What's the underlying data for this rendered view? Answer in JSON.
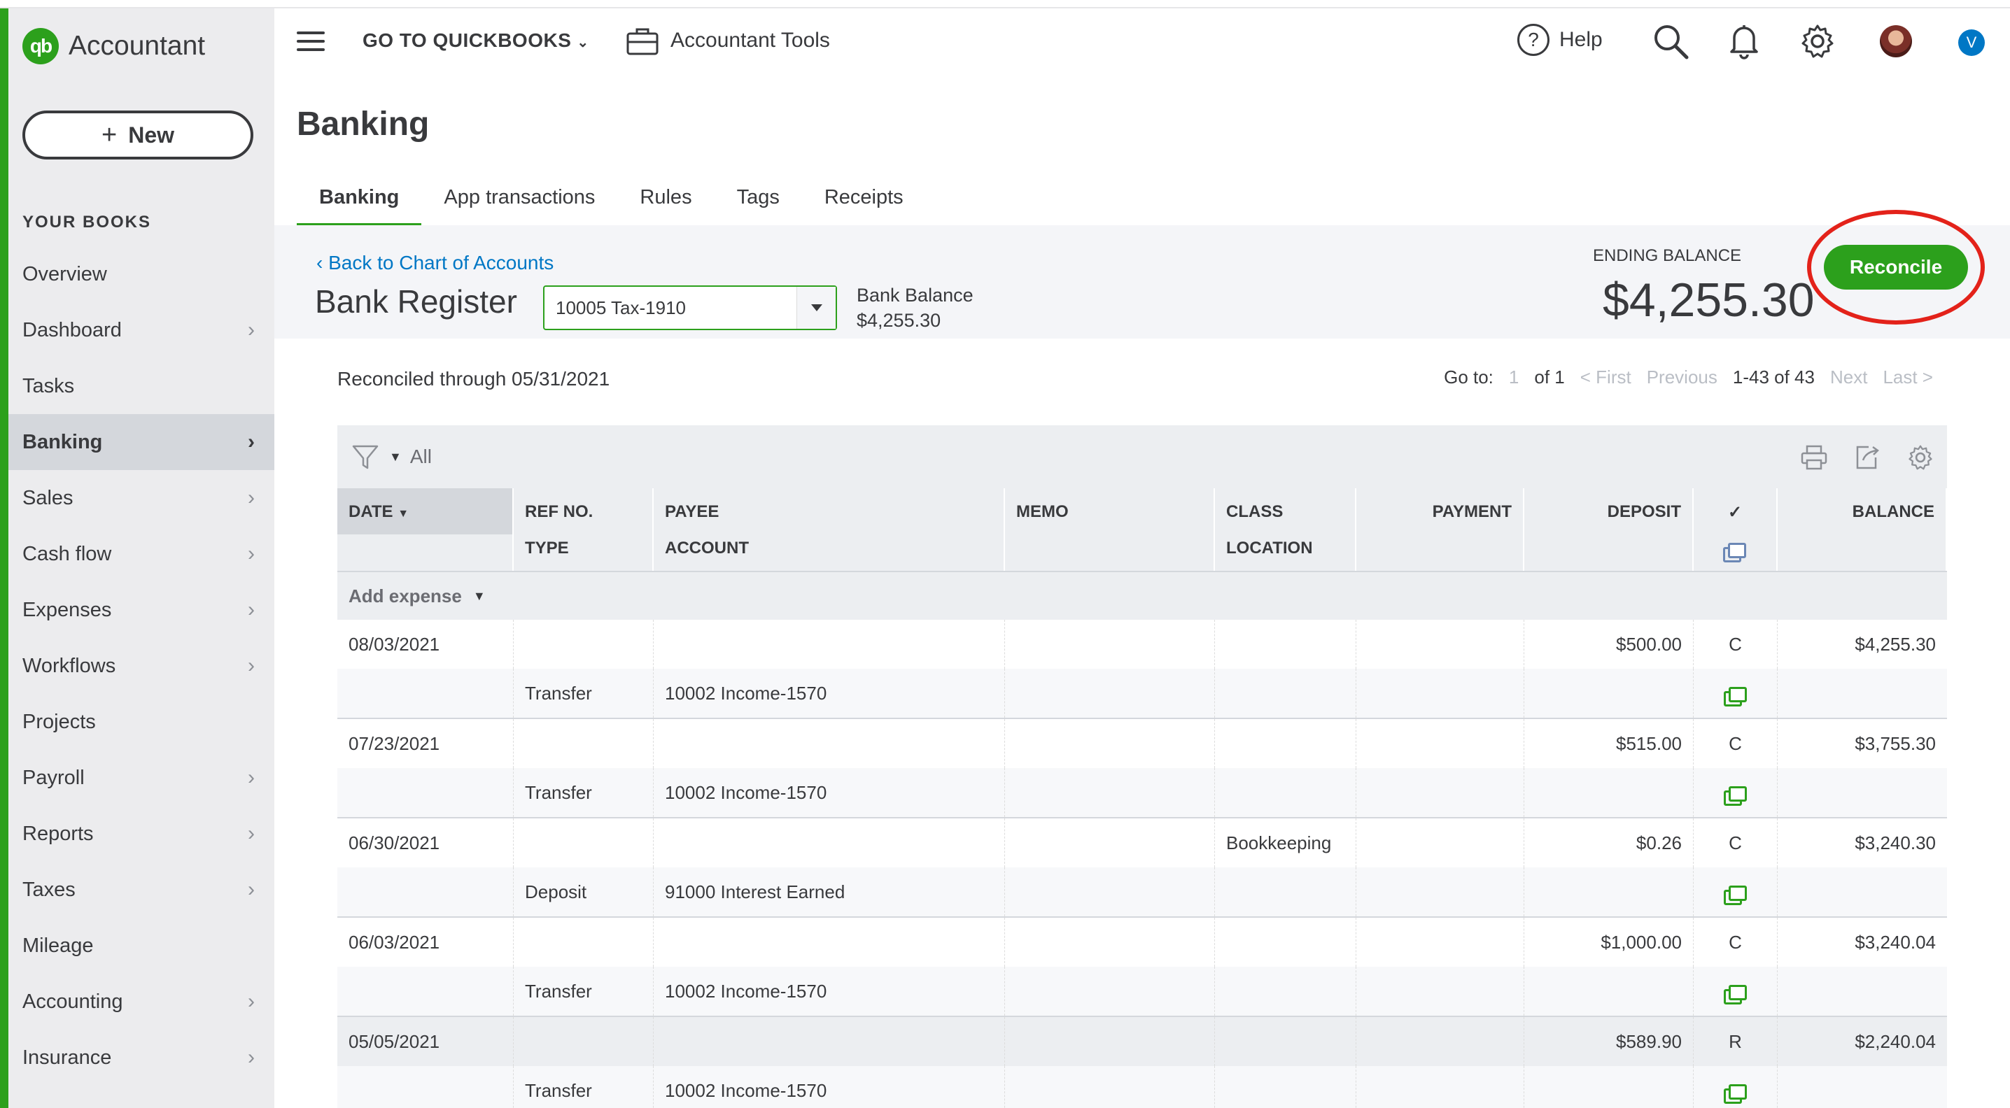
{
  "app": {
    "brand": "Accountant",
    "logo_text": "qb"
  },
  "sidebar": {
    "new_label": "New",
    "section_label": "YOUR BOOKS",
    "items": [
      {
        "label": "Overview",
        "chevron": false
      },
      {
        "label": "Dashboard",
        "chevron": true
      },
      {
        "label": "Tasks",
        "chevron": false
      },
      {
        "label": "Banking",
        "chevron": true,
        "active": true
      },
      {
        "label": "Sales",
        "chevron": true
      },
      {
        "label": "Cash flow",
        "chevron": true
      },
      {
        "label": "Expenses",
        "chevron": true
      },
      {
        "label": "Workflows",
        "chevron": true
      },
      {
        "label": "Projects",
        "chevron": false
      },
      {
        "label": "Payroll",
        "chevron": true
      },
      {
        "label": "Reports",
        "chevron": true
      },
      {
        "label": "Taxes",
        "chevron": true
      },
      {
        "label": "Mileage",
        "chevron": false
      },
      {
        "label": "Accounting",
        "chevron": true
      },
      {
        "label": "Insurance",
        "chevron": true
      }
    ]
  },
  "topbar": {
    "goto_label": "GO TO QUICKBOOKS",
    "tools_label": "Accountant Tools",
    "help_label": "Help",
    "user_initial": "V"
  },
  "page": {
    "title": "Banking",
    "tabs": [
      "Banking",
      "App transactions",
      "Rules",
      "Tags",
      "Receipts"
    ],
    "active_tab": "Banking"
  },
  "register": {
    "back_link": "Back to Chart of Accounts",
    "title": "Bank Register",
    "account_value": "10005 Tax-1910",
    "bank_balance_label": "Bank Balance",
    "bank_balance_value": "$4,255.30",
    "ending_balance_label": "ENDING BALANCE",
    "ending_balance_value": "$4,255.30",
    "reconcile_label": "Reconcile",
    "reconciled_through": "Reconciled through 05/31/2021"
  },
  "pager": {
    "goto_label": "Go to:",
    "page_value": "1",
    "of_label": "of 1",
    "first": "< First",
    "previous": "Previous",
    "range": "1-43 of 43",
    "next": "Next",
    "last": "Last >"
  },
  "table": {
    "filter_value": "All",
    "headers": {
      "date": "DATE",
      "ref": "REF NO.",
      "type": "TYPE",
      "payee": "PAYEE",
      "account": "ACCOUNT",
      "memo": "MEMO",
      "class": "CLASS",
      "location": "LOCATION",
      "payment": "PAYMENT",
      "deposit": "DEPOSIT",
      "check": "✓",
      "balance": "BALANCE"
    },
    "add_label": "Add expense",
    "rows": [
      {
        "date": "08/03/2021",
        "ref": "",
        "payee": "",
        "memo": "",
        "class": "",
        "payment": "",
        "deposit": "$500.00",
        "status": "C",
        "balance": "$4,255.30",
        "type": "Transfer",
        "account": "10002 Income-1570",
        "location": ""
      },
      {
        "date": "07/23/2021",
        "ref": "",
        "payee": "",
        "memo": "",
        "class": "",
        "payment": "",
        "deposit": "$515.00",
        "status": "C",
        "balance": "$3,755.30",
        "type": "Transfer",
        "account": "10002 Income-1570",
        "location": ""
      },
      {
        "date": "06/30/2021",
        "ref": "",
        "payee": "",
        "memo": "",
        "class": "Bookkeeping",
        "payment": "",
        "deposit": "$0.26",
        "status": "C",
        "balance": "$3,240.30",
        "type": "Deposit",
        "account": "91000 Interest Earned",
        "location": ""
      },
      {
        "date": "06/03/2021",
        "ref": "",
        "payee": "",
        "memo": "",
        "class": "",
        "payment": "",
        "deposit": "$1,000.00",
        "status": "C",
        "balance": "$3,240.04",
        "type": "Transfer",
        "account": "10002 Income-1570",
        "location": ""
      },
      {
        "date": "05/05/2021",
        "ref": "",
        "payee": "",
        "memo": "",
        "class": "",
        "payment": "",
        "deposit": "$589.90",
        "status": "R",
        "balance": "$2,240.04",
        "type": "Transfer",
        "account": "10002 Income-1570",
        "location": ""
      }
    ]
  },
  "colors": {
    "brand_green": "#2ca01c",
    "link_blue": "#0077c5",
    "highlight_red": "#e3221a"
  },
  "icons": [
    "hamburger-icon",
    "briefcase-icon",
    "help-icon",
    "search-icon",
    "bell-icon",
    "gear-icon",
    "filter-icon",
    "print-icon",
    "export-icon",
    "settings-icon",
    "copy-icon"
  ]
}
